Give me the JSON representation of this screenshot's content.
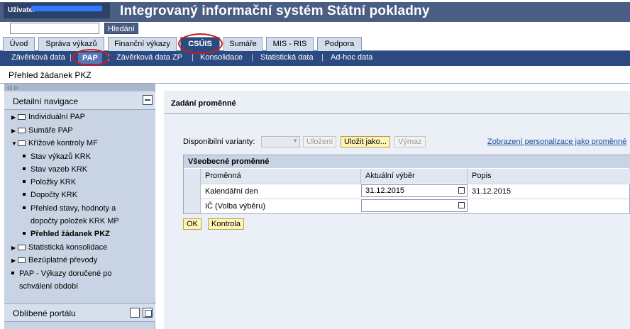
{
  "header": {
    "user_label": "Uživatel",
    "title": "Integrovaný informační systém Státní pokladny",
    "search_value": "",
    "search_button": "Hledání"
  },
  "topnav": [
    "Úvod",
    "Správa výkazů",
    "Finanční výkazy",
    "CSÚIS",
    "Sumáře",
    "MIS - RIS",
    "Podpora"
  ],
  "subnav": [
    "Závěrková data",
    "PAP",
    "Závěrková data ZP",
    "Konsolidace",
    "Statistická data",
    "Ad-hoc data"
  ],
  "page_title": "Přehled žádanek PKZ",
  "left_panel": {
    "header": "Detailní navigace",
    "items": [
      "Individuální PAP",
      "Sumáře PAP",
      "Křížové kontroly MF",
      "Stav výkazů KRK",
      "Stav vazeb KRK",
      "Položky KRK",
      "Dopočty KRK",
      "Přehled stavy, hodnoty a",
      "dopočty položek KRK MP",
      "Přehled žádanek PKZ",
      "Statistická konsolidace",
      "Bezúplatné převody",
      "PAP - Výkazy doručené po",
      "schválení období"
    ],
    "favorites": "Oblíbené portálu"
  },
  "content": {
    "section_title": "Zadání proměnné",
    "variants_label": "Disponibilní varianty:",
    "buttons": {
      "save": "Uložení",
      "save_as": "Uložit jako...",
      "delete": "Výmaz",
      "ok": "OK",
      "check": "Kontrola"
    },
    "personalization_link": "Zobrazení personalizace jako proměnné",
    "table": {
      "title": "Všeobecné proměnné",
      "columns": [
        "Proměnná",
        "Aktuální výběr",
        "Popis"
      ],
      "rows": [
        {
          "var": "Kalendářní den",
          "value": "31.12.2015",
          "desc": "31.12.2015"
        },
        {
          "var": "IČ (Volba výběru)",
          "value": "",
          "desc": ""
        }
      ]
    }
  }
}
